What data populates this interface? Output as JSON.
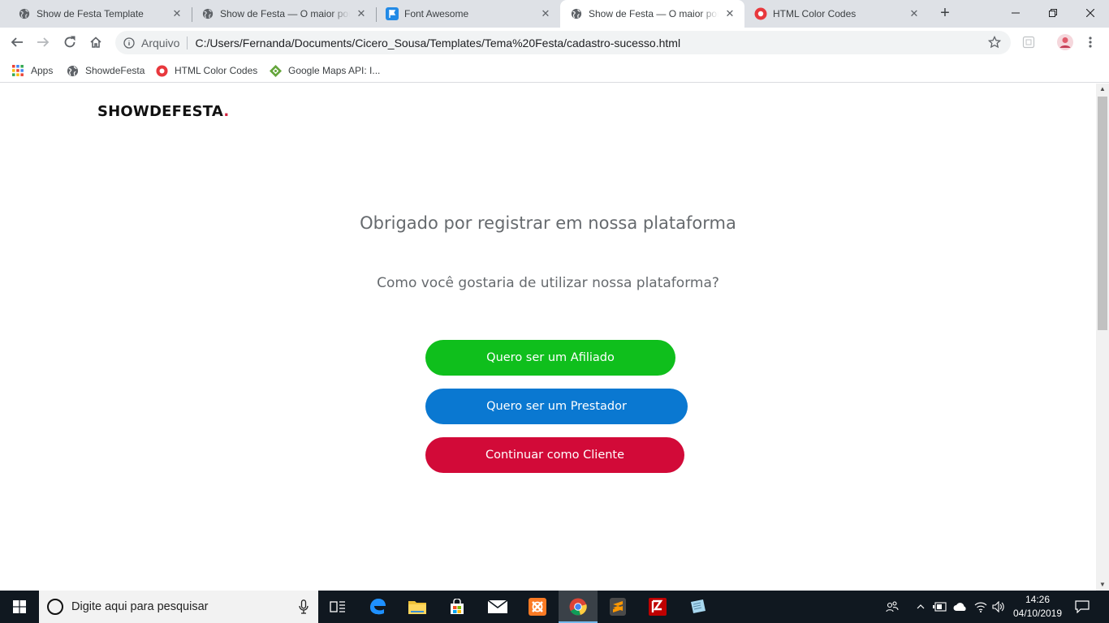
{
  "browser": {
    "tabs": [
      {
        "title": "Show de Festa Template",
        "icon": "globe-icon"
      },
      {
        "title": "Show de Festa — O maior portal de festas",
        "icon": "globe-icon"
      },
      {
        "title": "Font Awesome",
        "icon": "font-awesome-flag-icon"
      },
      {
        "title": "Show de Festa — O maior portal de festas",
        "icon": "globe-icon",
        "active": true
      },
      {
        "title": "HTML Color Codes",
        "icon": "htmlcolorcodes-icon"
      }
    ],
    "address": {
      "scheme_label": "Arquivo",
      "url": "C:/Users/Fernanda/Documents/Cicero_Sousa/Templates/Tema%20Festa/cadastro-sucesso.html"
    },
    "bookmarks": [
      {
        "label": "Apps",
        "icon": "apps-grid-icon"
      },
      {
        "label": "ShowdeFesta",
        "icon": "globe-icon"
      },
      {
        "label": "HTML Color Codes",
        "icon": "htmlcolorcodes-icon"
      },
      {
        "label": "Google Maps API: I...",
        "icon": "google-maps-icon"
      }
    ]
  },
  "page": {
    "logo": {
      "text": "SHOWDEFESTA",
      "dot": "."
    },
    "heading": "Obrigado por registrar em nossa plataforma",
    "subheading": "Como você gostaria de utilizar nossa plataforma?",
    "buttons": [
      {
        "label": "Quero ser um Afiliado",
        "color": "#0fbf1c"
      },
      {
        "label": "Quero ser um Prestador",
        "color": "#0a78d1"
      },
      {
        "label": "Continuar como Cliente",
        "color": "#d20a38"
      }
    ]
  },
  "taskbar": {
    "search_placeholder": "Digite aqui para pesquisar",
    "time": "14:26",
    "date": "04/10/2019"
  },
  "colors": {
    "brand_dot": "#d4213d",
    "taskbar": "#101820"
  }
}
